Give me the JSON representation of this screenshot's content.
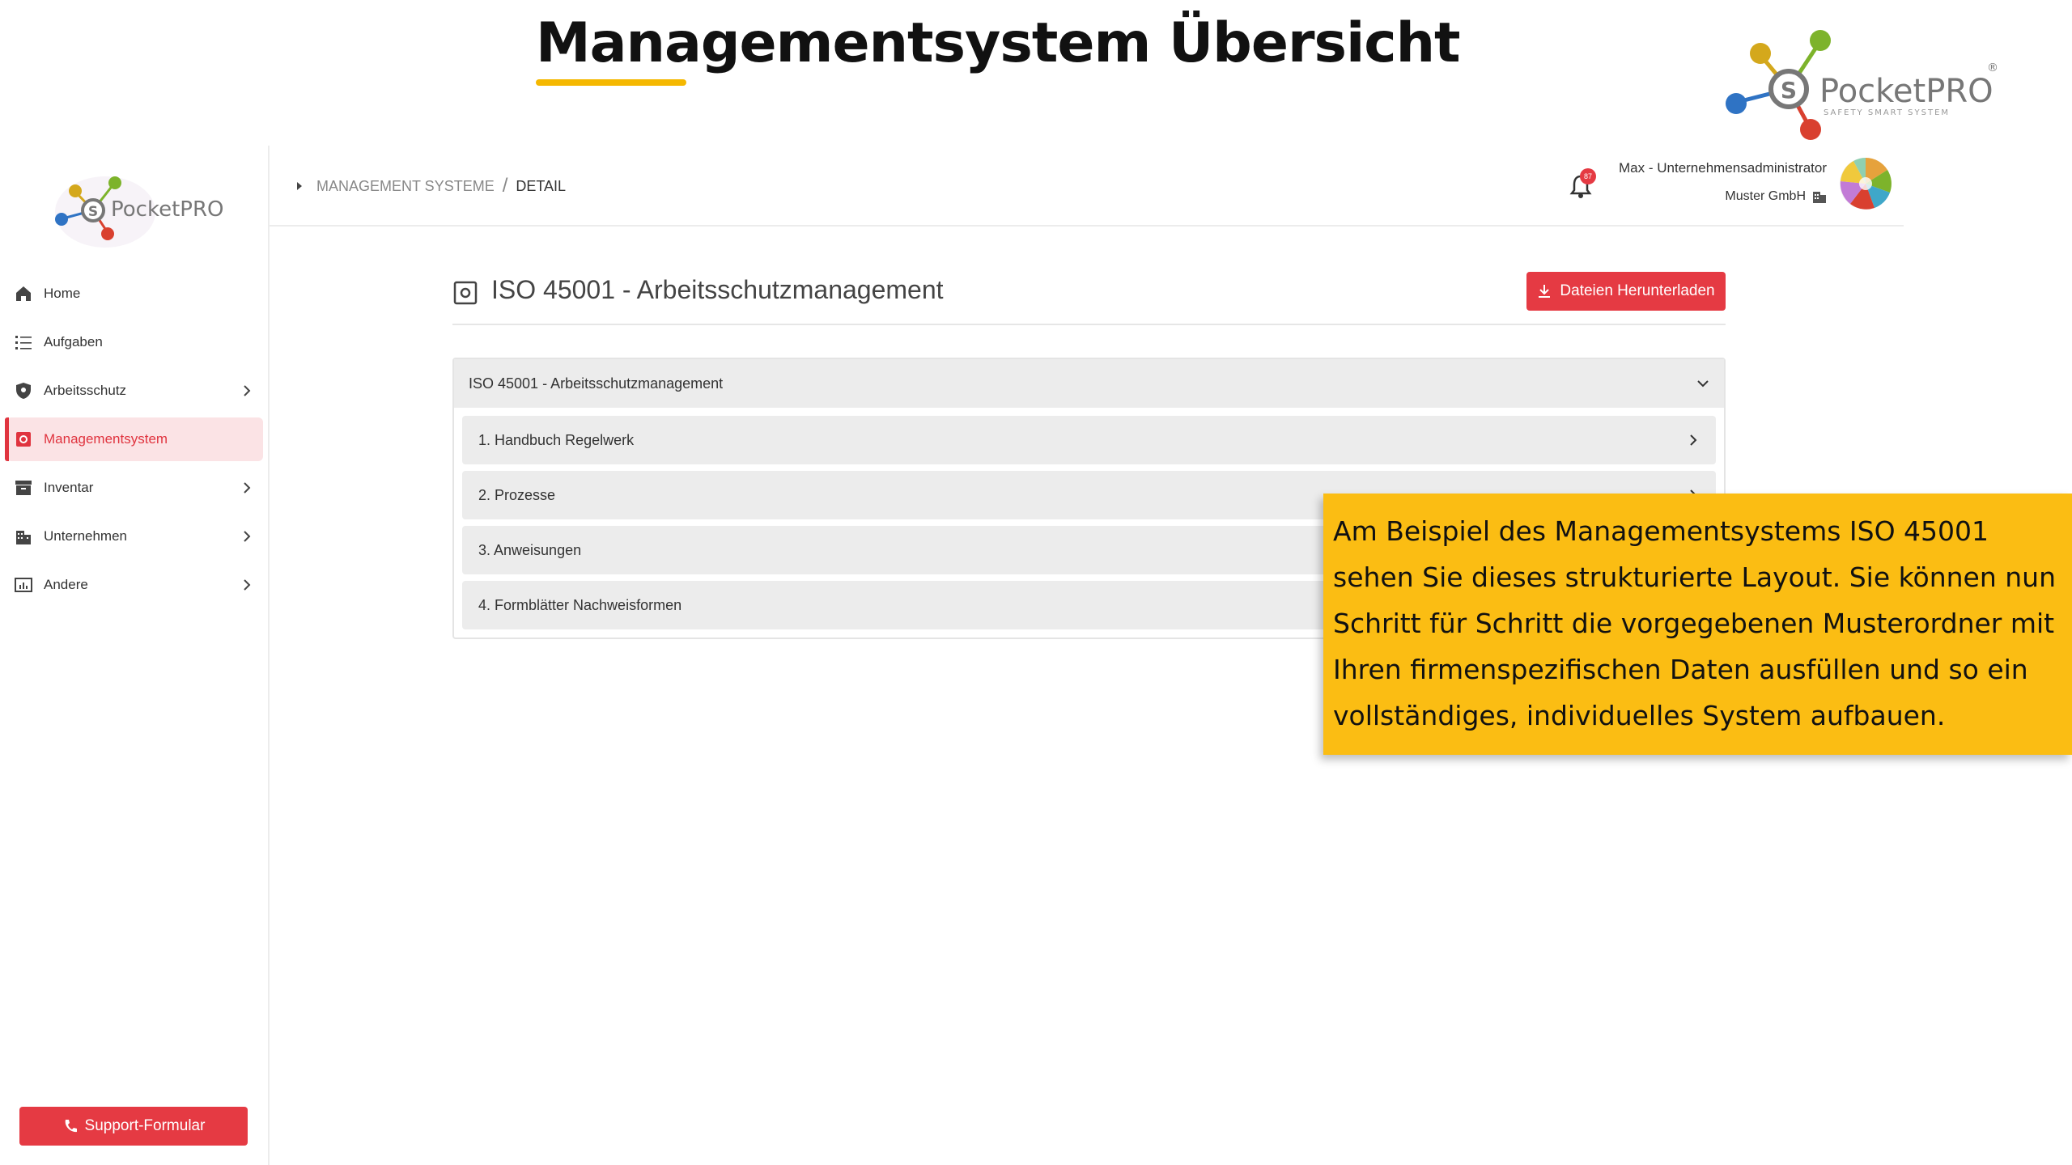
{
  "slide": {
    "title": "Managementsystem Übersicht",
    "accent_color": "#f5b800"
  },
  "brand": {
    "name": "PocketPRO",
    "tagline": "SAFETY SMART SYSTEM",
    "colors": [
      "#d4a81c",
      "#7db32b",
      "#2f73c4",
      "#d9402f",
      "#777777"
    ]
  },
  "sidebar": {
    "items": [
      {
        "label": "Home",
        "icon": "home-icon",
        "has_submenu": false,
        "active": false
      },
      {
        "label": "Aufgaben",
        "icon": "list-icon",
        "has_submenu": false,
        "active": false
      },
      {
        "label": "Arbeitsschutz",
        "icon": "shield-icon",
        "has_submenu": true,
        "active": false
      },
      {
        "label": "Managementsystem",
        "icon": "cog-square-icon",
        "has_submenu": false,
        "active": true
      },
      {
        "label": "Inventar",
        "icon": "archive-icon",
        "has_submenu": true,
        "active": false
      },
      {
        "label": "Unternehmen",
        "icon": "building-icon",
        "has_submenu": true,
        "active": false
      },
      {
        "label": "Andere",
        "icon": "chart-box-icon",
        "has_submenu": true,
        "active": false
      }
    ],
    "support_label": "Support-Formular"
  },
  "topbar": {
    "breadcrumb": [
      "MANAGEMENT SYSTEME",
      "DETAIL"
    ],
    "notification_count": "87",
    "user_name": "Max - Unternehmensadministrator",
    "company": "Muster GmbH"
  },
  "main": {
    "title": "ISO 45001 - Arbeitsschutzmanagement",
    "download_label": "Dateien Herunterladen",
    "accordion_title": "ISO 45001 - Arbeitsschutzmanagement",
    "folders": [
      "1. Handbuch Regelwerk",
      "2. Prozesse",
      "3. Anweisungen",
      "4. Formblätter Nachweisformen"
    ]
  },
  "callout": {
    "text": "Am Beispiel des Managementsystems ISO 45001 sehen Sie dieses strukturierte Layout. Sie können nun Schritt für Schritt die vorgegebenen Musterordner mit Ihren firmenspezifischen Daten ausfüllen und so ein vollständiges, individuelles System aufbauen.",
    "background": "#fbbd13"
  },
  "theme": {
    "primary_red": "#e53a43",
    "active_bg": "#fbe3e5"
  }
}
